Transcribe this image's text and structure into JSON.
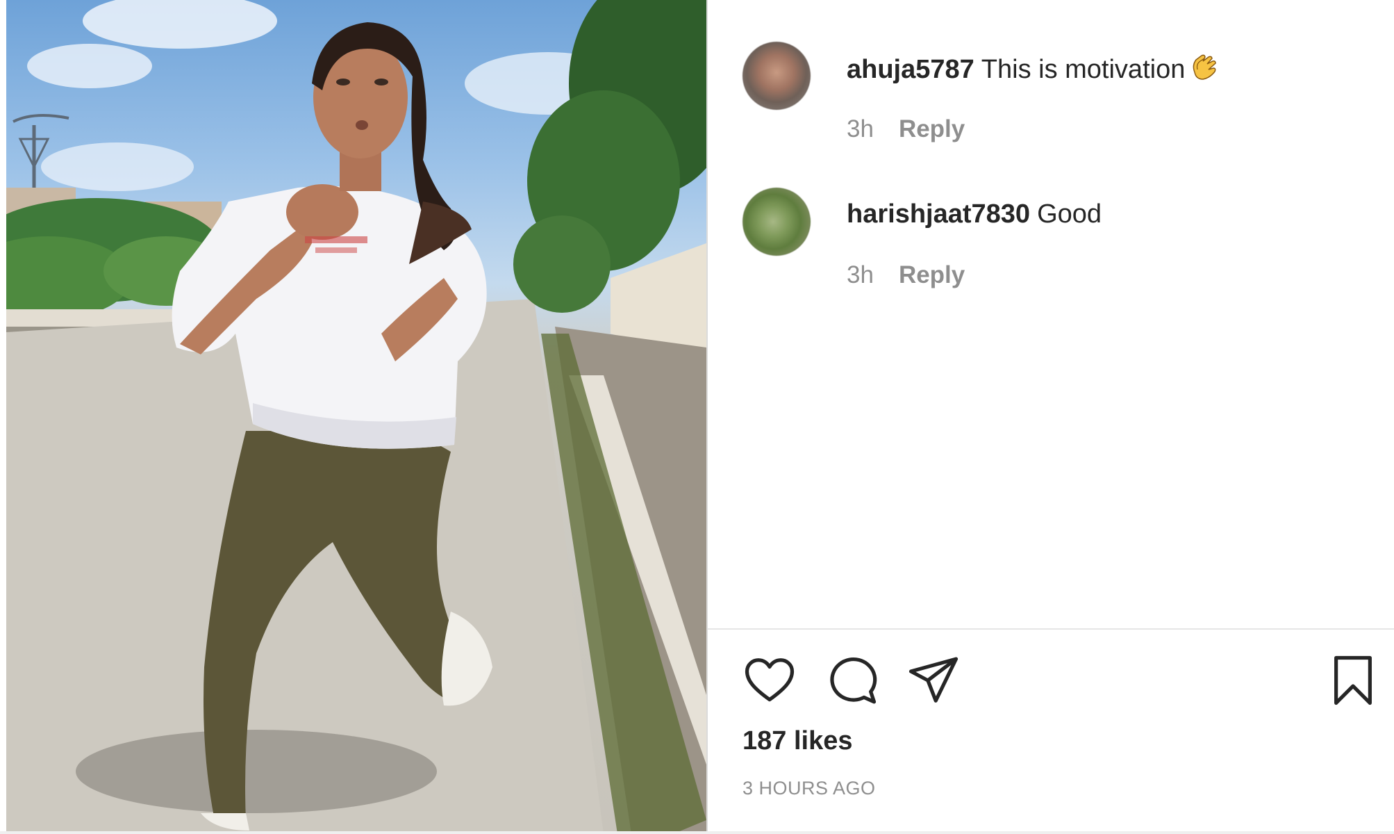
{
  "post": {
    "comments": [
      {
        "username": "ahuja5787",
        "text": "This is motivation",
        "emoji": "clapping-hands-icon",
        "time": "3h",
        "reply_label": "Reply"
      },
      {
        "username": "harishjaat7830",
        "text": "Good",
        "time": "3h",
        "reply_label": "Reply"
      }
    ],
    "actions": {
      "like_icon": "heart-icon",
      "comment_icon": "speech-bubble-icon",
      "share_icon": "paper-plane-icon",
      "save_icon": "bookmark-icon"
    },
    "likes_text": "187 likes",
    "time_ago": "3 HOURS AGO"
  },
  "colors": {
    "text_primary": "#262626",
    "text_secondary": "#8e8e8e",
    "divider": "#e6e6e6"
  }
}
